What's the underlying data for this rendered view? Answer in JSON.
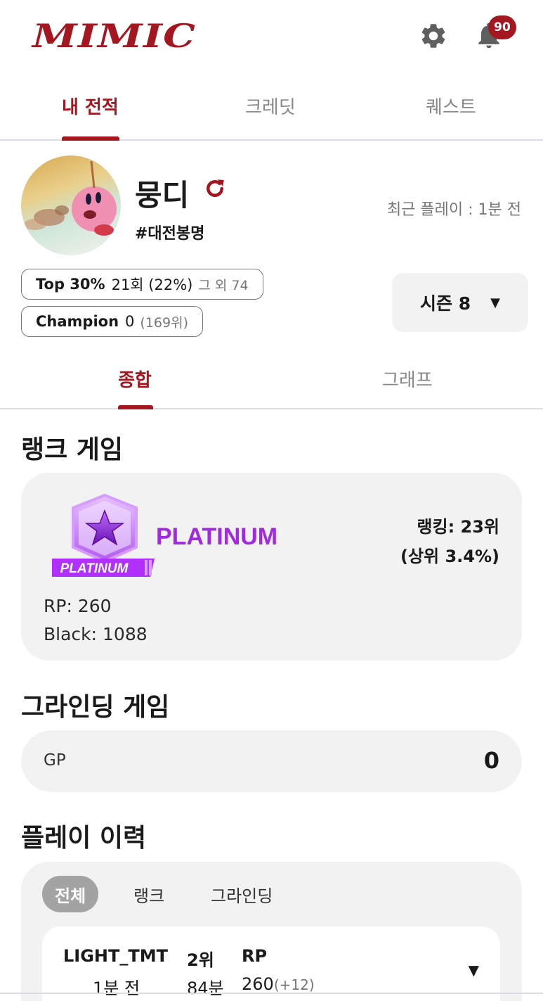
{
  "header": {
    "logo": "MIMIC",
    "notification_count": "90"
  },
  "top_tabs": [
    "내 전적",
    "크레딧",
    "퀘스트"
  ],
  "profile": {
    "nickname": "뭉디",
    "tag": "#대전봉명",
    "recent_play": "최근 플레이 : 1분 전",
    "top_pill": {
      "label": "Top 30%",
      "value": "21회 (22%)",
      "extra": "그 외 74"
    },
    "champion_pill": {
      "label": "Champion",
      "value": "0",
      "extra": "(169위)"
    },
    "season": "시즌 8"
  },
  "sub_tabs": [
    "종합",
    "그래프"
  ],
  "rank_game": {
    "title": "랭크 게임",
    "emblem_text": "PLATINUM",
    "tier": "PLATINUM",
    "ranking_line1": "랭킹: 23위",
    "ranking_line2": "(상위 3.4%)",
    "rp": "RP: 260",
    "black": "Black: 1088"
  },
  "grinding_game": {
    "title": "그라인딩 게임",
    "label": "GP",
    "value": "0"
  },
  "play_history": {
    "title": "플레이 이력",
    "filters": [
      "전체",
      "랭크",
      "그라인딩"
    ],
    "rows": [
      {
        "mode": "LIGHT_TMT",
        "time_ago": "1분 전",
        "place": "2위",
        "duration": "84분",
        "rp_label": "RP",
        "rp_value": "260",
        "rp_change": "(+12)"
      }
    ]
  },
  "colors": {
    "brand": "#a41720",
    "platinum": "#a12ae0",
    "card_bg": "#f2f2f2"
  }
}
